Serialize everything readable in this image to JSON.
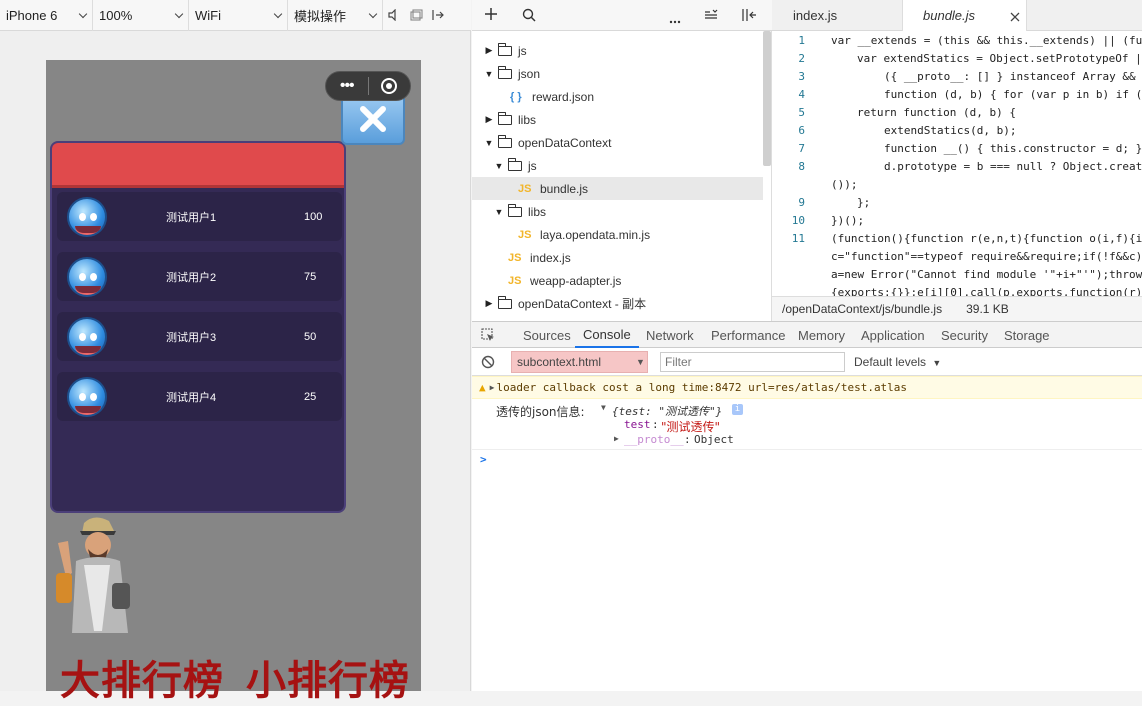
{
  "toolbar": {
    "device": "iPhone 6",
    "zoom": "100%",
    "network": "WiFi",
    "operation": "模拟操作"
  },
  "game": {
    "close_glyph": "X",
    "capsule_more": "•••",
    "rank_rows": [
      {
        "name": "测试用户1",
        "score": "100"
      },
      {
        "name": "测试用户2",
        "score": "75"
      },
      {
        "name": "测试用户3",
        "score": "50"
      },
      {
        "name": "测试用户4",
        "score": "25"
      }
    ],
    "big_rank_label": "大排行榜",
    "small_rank_label": "小排行榜"
  },
  "file_tree": [
    {
      "label": "js",
      "type": "folder",
      "open": false
    },
    {
      "label": "json",
      "type": "folder",
      "open": true
    },
    {
      "label": "reward.json",
      "type": "json"
    },
    {
      "label": "libs",
      "type": "folder",
      "open": false
    },
    {
      "label": "openDataContext",
      "type": "folder",
      "open": true
    },
    {
      "label": "js",
      "type": "folder",
      "open": true
    },
    {
      "label": "bundle.js",
      "type": "js",
      "selected": true
    },
    {
      "label": "libs",
      "type": "folder",
      "open": true
    },
    {
      "label": "laya.opendata.min.js",
      "type": "js"
    },
    {
      "label": "index.js",
      "type": "js"
    },
    {
      "label": "weapp-adapter.js",
      "type": "js"
    },
    {
      "label": "openDataContext - 副本",
      "type": "folder",
      "open": false
    }
  ],
  "editor": {
    "tabs": [
      {
        "label": "index.js",
        "active": false
      },
      {
        "label": "bundle.js",
        "active": true
      }
    ],
    "lines": [
      {
        "n": "1",
        "indent": 0,
        "code": "var __extends = (this && this.__extends) || (fu"
      },
      {
        "n": "2",
        "indent": 1,
        "code": "var extendStatics = Object.setPrototypeOf ||"
      },
      {
        "n": "3",
        "indent": 2,
        "code": "({ __proto__: [] } instanceof Array && f"
      },
      {
        "n": "4",
        "indent": 2,
        "code": "function (d, b) { for (var p in b) if (b"
      },
      {
        "n": "5",
        "indent": 1,
        "code": "return function (d, b) {"
      },
      {
        "n": "6",
        "indent": 2,
        "code": "extendStatics(d, b);"
      },
      {
        "n": "7",
        "indent": 2,
        "code": "function __() { this.constructor = d; }"
      },
      {
        "n": "8",
        "indent": 2,
        "code": "d.prototype = b === null ? Object.creat"
      },
      {
        "n": "",
        "indent": 0,
        "code": "());"
      },
      {
        "n": "9",
        "indent": 1,
        "code": "};"
      },
      {
        "n": "10",
        "indent": 0,
        "code": "})();"
      },
      {
        "n": "11",
        "indent": 0,
        "code": "(function(){function r(e,n,t){function o(i,f){if"
      },
      {
        "n": "",
        "indent": 0,
        "code": "c=\"function\"==typeof require&&require;if(!f&&c)"
      },
      {
        "n": "",
        "indent": 0,
        "code": "a=new Error(\"Cannot find module '\"+i+\"'\");throw"
      },
      {
        "n": "",
        "indent": 0,
        "code": "{exports:{}};e[i][0].call(p.exports,function(r)"
      }
    ],
    "status_path": "/openDataContext/js/bundle.js",
    "status_size": "39.1 KB"
  },
  "devtools": {
    "tabs": [
      "Sources",
      "Console",
      "Network",
      "Performance",
      "Memory",
      "Application",
      "Security",
      "Storage"
    ],
    "active_tab": "Console",
    "context": "subcontext.html",
    "filter_placeholder": "Filter",
    "levels": "Default levels",
    "warning": "loader callback cost a long time:8472 url=res/atlas/test.atlas",
    "log_label": "透传的json信息:",
    "log_obj": "{test: \"测试透传\"}",
    "log_obj_key": "test",
    "log_prop_key": "test",
    "log_prop_val": "\"测试透传\"",
    "log_proto_key": "__proto__",
    "log_proto_val": "Object",
    "prompt": ">"
  },
  "colors": {
    "panel_bg": "#342a55",
    "panel_header": "#e04a4c",
    "title_red": "#a61212",
    "context_bg": "#f6c6c6",
    "accent": "#1a73e8"
  }
}
